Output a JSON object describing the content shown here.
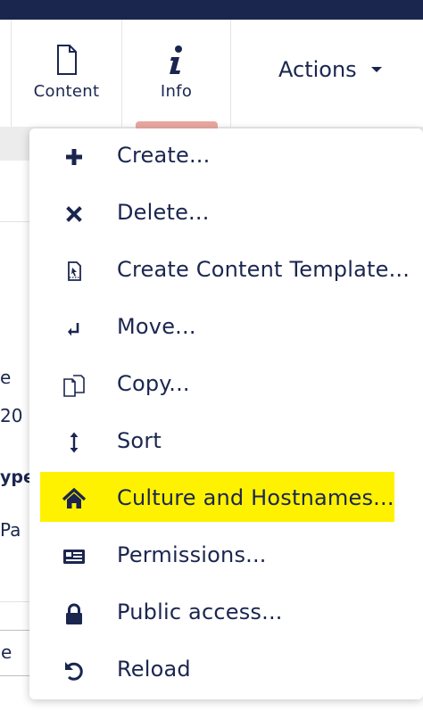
{
  "header": {
    "content_label": "Content",
    "info_label": "Info",
    "actions_label": "Actions",
    "content_icon": "document-icon",
    "info_icon": "info-icon",
    "caret_icon": "caret-down-icon"
  },
  "background_fragments": {
    "frag1": "e",
    "frag2": "20",
    "frag3": "ype",
    "frag4": "Pa",
    "field_value": "e"
  },
  "menu": {
    "items": [
      {
        "label": "Create...",
        "icon": "plus-icon"
      },
      {
        "label": "Delete...",
        "icon": "times-icon"
      },
      {
        "label": "Create Content Template...",
        "icon": "blueprint-icon"
      },
      {
        "label": "Move...",
        "icon": "move-icon"
      },
      {
        "label": "Copy...",
        "icon": "copy-icon"
      },
      {
        "label": "Sort",
        "icon": "sort-icon"
      },
      {
        "label": "Culture and Hostnames...",
        "icon": "home-icon",
        "highlighted": true
      },
      {
        "label": "Permissions...",
        "icon": "permissions-icon"
      },
      {
        "label": "Public access...",
        "icon": "lock-icon"
      },
      {
        "label": "Reload",
        "icon": "reload-icon"
      }
    ]
  },
  "colors": {
    "text": "#1b264f",
    "highlight": "#fff200",
    "topbar": "#1b264f",
    "tab_indicator": "#e8a8a0"
  }
}
